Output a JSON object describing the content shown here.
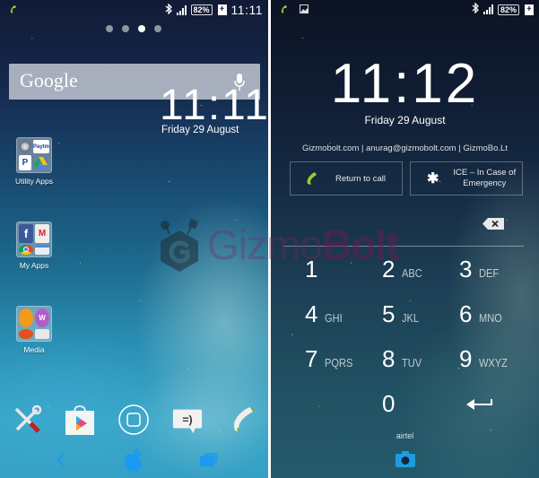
{
  "left_screen": {
    "name": "Home screen",
    "statusbar": {
      "call_icon": "phone-call-active-icon",
      "bluetooth_icon": "bluetooth-icon",
      "signal_icon": "signal-strength-icon",
      "battery_percent": "82%",
      "charging_icon": "plus-charging-icon",
      "time": "11:11"
    },
    "page_indicator": {
      "count": 4,
      "active_index": 2
    },
    "google_search": {
      "logo_text": "Google",
      "mic_icon": "microphone-icon"
    },
    "clock_widget": {
      "time": "11:11",
      "date": "Friday 29 August"
    },
    "folders": [
      {
        "label": "Utility Apps",
        "apps": [
          "Settings-eye",
          "Paytm",
          "PayPal",
          "Google Drive"
        ]
      },
      {
        "label": "My Apps",
        "apps": [
          "Facebook",
          "Gmail",
          "Chrome",
          "Browser"
        ]
      },
      {
        "label": "Media",
        "apps": [
          "Video Player",
          "Walkman",
          "Movies",
          "Radio"
        ]
      }
    ],
    "dock": [
      {
        "name": "Tools",
        "icon": "tools-wrench-screwdriver-icon"
      },
      {
        "name": "Play Store",
        "icon": "play-store-bag-icon"
      },
      {
        "name": "Apps drawer",
        "icon": "home-square-button-icon"
      },
      {
        "name": "Messaging",
        "icon": "smiley-message-bubble-icon",
        "glyph": "=)"
      },
      {
        "name": "Phone",
        "icon": "phone-handset-icon"
      }
    ],
    "navbar": [
      {
        "name": "Back",
        "icon": "back-chevron-icon"
      },
      {
        "name": "Home",
        "icon": "apple-logo-icon"
      },
      {
        "name": "Recents",
        "icon": "recent-apps-icon"
      }
    ],
    "watermark": {
      "text_light": "Gizmo",
      "text_bold": "Bolt"
    }
  },
  "right_screen": {
    "name": "Lock screen PIN",
    "statusbar": {
      "call_icon": "phone-call-active-icon",
      "gallery_icon": "image-notification-icon",
      "bluetooth_icon": "bluetooth-icon",
      "signal_icon": "signal-strength-icon",
      "battery_percent": "82%",
      "charging_icon": "plus-charging-icon"
    },
    "clock": {
      "time": "11:12",
      "date": "Friday 29 August"
    },
    "owner_info": "Gizmobolt.com | anurag@gizmobolt.com | GizmoBo.Lt",
    "buttons": {
      "return_to_call": "Return to call",
      "ice_line1": "ICE – In Case of",
      "ice_line2": "Emergency"
    },
    "keypad": [
      {
        "digit": "1",
        "letters": ""
      },
      {
        "digit": "2",
        "letters": "ABC"
      },
      {
        "digit": "3",
        "letters": "DEF"
      },
      {
        "digit": "4",
        "letters": "GHI"
      },
      {
        "digit": "5",
        "letters": "JKL"
      },
      {
        "digit": "6",
        "letters": "MNO"
      },
      {
        "digit": "7",
        "letters": "PQRS"
      },
      {
        "digit": "8",
        "letters": "TUV"
      },
      {
        "digit": "9",
        "letters": "WXYZ"
      },
      {
        "digit": "0",
        "letters": ""
      }
    ],
    "carrier": "airtel",
    "camera_icon": "camera-icon",
    "colors": {
      "accent_green": "#9ccc2a",
      "accent_blue": "#1a9af0"
    }
  }
}
